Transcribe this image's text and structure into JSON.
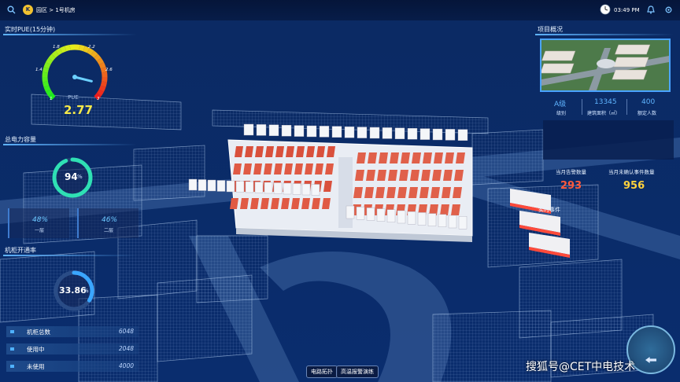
{
  "header": {
    "breadcrumb": "园区 > 1号机房",
    "logo_letter": "K",
    "time": "03:49 PM"
  },
  "pue": {
    "title": "实时PUE(15分钟)",
    "ticks": [
      "1",
      "1.4",
      "1.8",
      "2.2",
      "2.6",
      "3"
    ],
    "label": "PUE",
    "value": "2.77",
    "value_number": 2.77,
    "min": 1,
    "max": 3
  },
  "power": {
    "title": "总电力容量",
    "percent_text": "94",
    "percent_unit": "%",
    "fraction": 0.94,
    "floors": [
      {
        "value": "48%",
        "label": "一层"
      },
      {
        "value": "46%",
        "label": "二层"
      }
    ]
  },
  "rack": {
    "title": "机柜开通率",
    "percent_text": "33.86",
    "percent_unit": "%",
    "fraction": 0.3386,
    "rows": [
      {
        "label": "机柜总数",
        "value": "6048"
      },
      {
        "label": "使用中",
        "value": "2048"
      },
      {
        "label": "未使用",
        "value": "4000"
      }
    ]
  },
  "project": {
    "title": "项目概况",
    "stats": [
      {
        "value": "A级",
        "label": "级别"
      },
      {
        "value": "13345",
        "label": "建筑面积（㎡）"
      },
      {
        "value": "400",
        "label": "额定人数"
      }
    ]
  },
  "alarms": {
    "month_alarm_label": "当月告警数量",
    "month_alarm_value": "293",
    "unconfirmed_label": "当月未确认事件数量",
    "unconfirmed_value": "956",
    "realtime_title": "实时事件"
  },
  "bottom_buttons": [
    "电路拓扑",
    "高温报警演练"
  ],
  "watermark": "搜狐号@CET中电技术",
  "colors": {
    "accent": "#4fb1ff",
    "alarm_red": "#ff5a3c",
    "warn_yellow": "#ffd23c",
    "pue_value": "#f5e94a"
  }
}
